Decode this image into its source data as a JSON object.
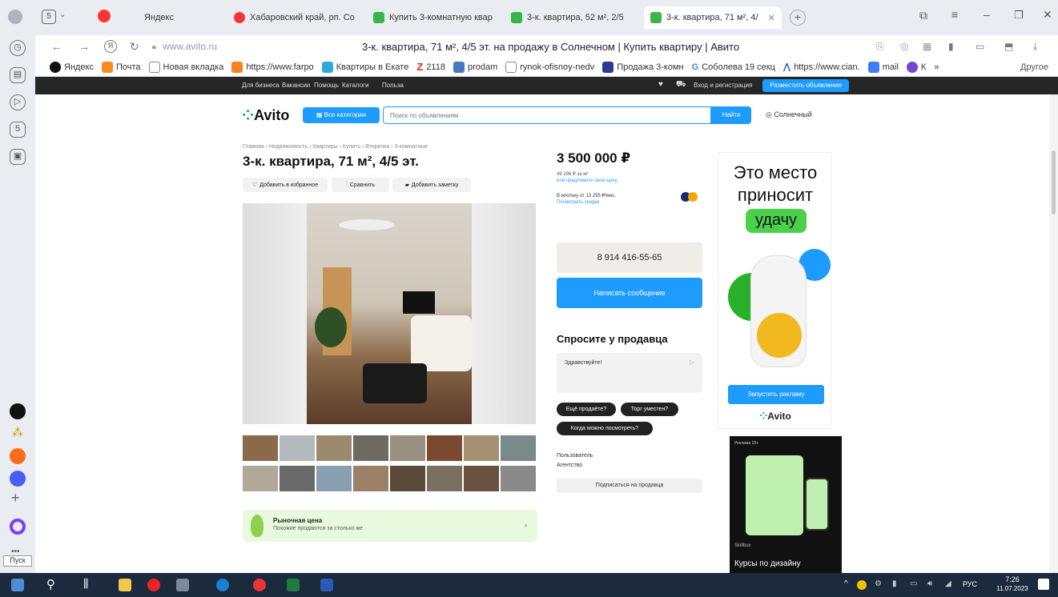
{
  "browser": {
    "tabs": [
      {
        "label": "Яндекс"
      },
      {
        "label": "Хабаровский край, рп. Со"
      },
      {
        "label": "Купить 3-комнатную квар"
      },
      {
        "label": "3-к. квартира, 52 м², 2/5"
      },
      {
        "label": "3-к. квартира, 71 м², 4/"
      }
    ],
    "tab_counter": "5",
    "address": "www.avito.ru",
    "page_title": "3-к. квартира, 71 м², 4/5 эт. на продажу в Солнечном | Купить квартиру | Авито",
    "bookmarks": [
      {
        "label": "Яндекс"
      },
      {
        "label": "Почта"
      },
      {
        "label": "Новая вкладка"
      },
      {
        "label": "https://www.farpo"
      },
      {
        "label": "Квартиры в Екате"
      },
      {
        "label": "2118"
      },
      {
        "label": "prodam"
      },
      {
        "label": "rynok-ofisnoy-nedv"
      },
      {
        "label": "Продажа 3-комн"
      },
      {
        "label": "Соболева 19 секц"
      },
      {
        "label": "https://www.cian."
      },
      {
        "label": "mail"
      },
      {
        "label": "К"
      }
    ],
    "bookmarks_more": "»",
    "bookmarks_other": "Другое"
  },
  "avito_topbar": {
    "links": [
      "Для бизнеса",
      "Вакансии",
      "Помощь",
      "Каталоги",
      "Польза"
    ],
    "login": "Вход и регистрация",
    "post_ad": "Разместить объявление"
  },
  "header": {
    "logo": "Avito",
    "categories_button": "Все категории",
    "search_placeholder": "Поиск по объявлениям",
    "search_button": "Найти",
    "location": "Солнечный"
  },
  "listing": {
    "breadcrumbs": "Главная › Недвижимость › Квартиры › Купить › Вторичка › 3-комнатные",
    "title": "3-к. квартира, 71 м², 4/5 эт.",
    "actions": [
      "Добавить в избранное",
      "Сравнить",
      "Добавить заметку"
    ],
    "market_price_title": "Рыночная цена",
    "market_price_sub": "Похожие продаются за столько же"
  },
  "seller_panel": {
    "price": "3 500 000 ₽",
    "price_per_m2": "49 296 ₽ за м²",
    "offer_link": "или предложите свою цену",
    "mortgage": "В ипотеку от 13 255 ₽/мес.",
    "mortgage_link": "Посмотреть скидки",
    "phone": "8 914 416-55-65",
    "message_button": "Написать сообщение",
    "ask_title": "Спросите у продавца",
    "ask_text": "Здравствуйте!",
    "quick_questions": [
      "Ещё продаёте?",
      "Торг уместен?",
      "Когда можно посмотреть?"
    ],
    "seller_type": "Пользователь",
    "seller_agency": "Агентство",
    "subscribe_button": "Подписаться на продавца"
  },
  "ad_banner": {
    "line1": "Это место",
    "line2": "приносит",
    "line3": "удачу",
    "button": "Запустить рекламу",
    "logo": "Avito",
    "ad2_label": "Реклама 18+",
    "ad2_brand": "Skillbox",
    "ad2_text": "Курсы по дизайну"
  },
  "taskbar": {
    "start_label": "Пуск",
    "lang": "РУС",
    "time": "7:26",
    "date": "11.07.2023"
  },
  "colors": {
    "accent_blue": "#1e9bff",
    "avito_green": "#00b83f",
    "dark_bar": "#262626"
  }
}
